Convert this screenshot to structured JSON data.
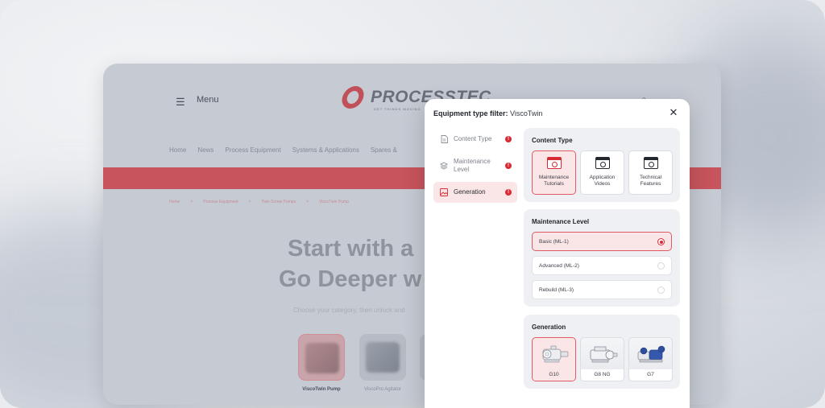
{
  "site": {
    "menu_label": "Menu",
    "logo_text": "PROCESSTEC",
    "logo_tagline": "GET THINGS MOVING",
    "nav": [
      "Home",
      "News",
      "Process Equipment",
      "Systems & Applications",
      "Spares &"
    ],
    "breadcrumbs": [
      "Home",
      "Process Equipment",
      "Twin Screw Pumps",
      "ViscoTwin Pump"
    ],
    "hero_line1": "Start with a",
    "hero_line2": "Go Deeper w",
    "hero_sub": "Choose your category, then unlock and",
    "tiles": [
      {
        "label": "ViscoTwin Pump"
      },
      {
        "label": "ViscoPro Agitator"
      }
    ]
  },
  "modal": {
    "title_prefix": "Equipment type filter: ",
    "title_value": "ViscoTwin",
    "sidebar": [
      {
        "label": "Content Type",
        "icon": "document-icon",
        "badge": "!"
      },
      {
        "label": "Maintenance Level",
        "icon": "layers-icon",
        "badge": "!"
      },
      {
        "label": "Generation",
        "icon": "gallery-icon",
        "badge": "!"
      }
    ],
    "content_type": {
      "heading": "Content Type",
      "options": [
        {
          "label": "Maintenance Tutorials",
          "selected": true
        },
        {
          "label": "Application Videos",
          "selected": false
        },
        {
          "label": "Technical Features",
          "selected": false
        }
      ]
    },
    "maintenance_level": {
      "heading": "Maintenance Level",
      "options": [
        {
          "label": "Basic (ML-1)",
          "selected": true
        },
        {
          "label": "Advanced (ML-2)",
          "selected": false
        },
        {
          "label": "Rebuild (ML-3)",
          "selected": false
        }
      ]
    },
    "generation": {
      "heading": "Generation",
      "options": [
        {
          "label": "G10",
          "selected": true
        },
        {
          "label": "G8 NG",
          "selected": false
        },
        {
          "label": "G7",
          "selected": false
        }
      ]
    }
  },
  "colors": {
    "accent": "#d82a35",
    "selected_bg": "#fbe6e7"
  }
}
